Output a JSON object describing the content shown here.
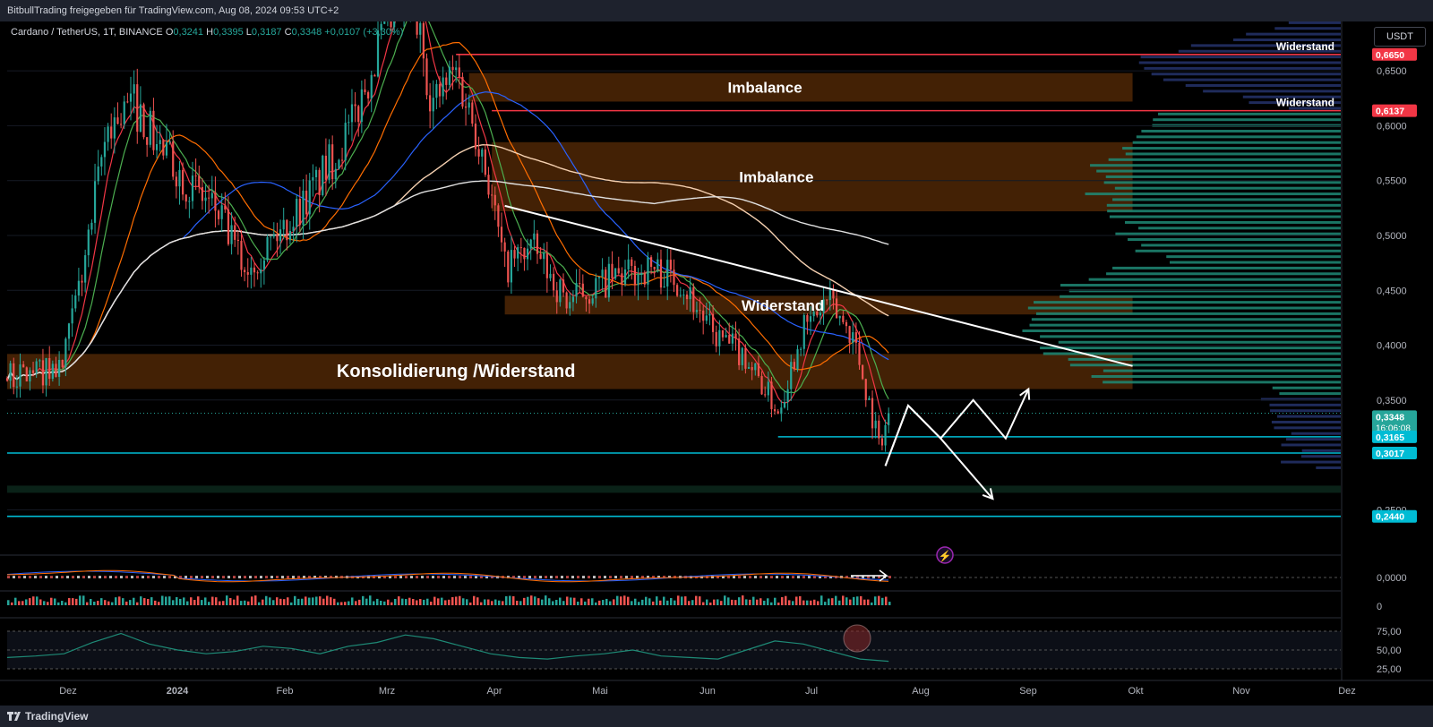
{
  "header": {
    "attribution": "BitbullTrading freigegeben für TradingView.com, Aug 08, 2024 09:53 UTC+2"
  },
  "symbol": {
    "name": "Cardano / TetherUS, 1T, BINANCE",
    "o_label": "O",
    "o_value": "0,3241",
    "h_label": "H",
    "h_value": "0,3395",
    "l_label": "L",
    "l_value": "0,3187",
    "c_label": "C",
    "c_value": "0,3348",
    "change": "+0,0107 (+3,30%)"
  },
  "currency": "USDT",
  "footer": {
    "brand": "TradingView",
    "logo_icon": "tradingview-logo-icon"
  },
  "colors": {
    "background": "#000000",
    "zone_fill": "#7a3d0a",
    "resistance_red": "#f23645",
    "support_cyan": "#00bcd4",
    "volume_profile_green": "#1e8a76",
    "volume_profile_blue": "#24336b",
    "candle_up": "#26a69a",
    "candle_down": "#ef5350",
    "ma_red": "#f23645",
    "ma_green": "#4caf50",
    "ma_orange": "#ff6d00",
    "ma_blue": "#2962ff",
    "ma_beige": "#f5d0b0",
    "ma_white": "#e0e0e0",
    "rsi_line": "#1e8a76"
  },
  "chart_data": {
    "type": "candlestick",
    "timeframe": "1T",
    "price_axis": {
      "ylim": [
        0.225,
        0.695
      ],
      "ticks": [
        "0,6500",
        "0,6000",
        "0,5500",
        "0,5000",
        "0,4500",
        "0,4000",
        "0,3500",
        "0,2500"
      ],
      "tick_values": [
        0.65,
        0.6,
        0.55,
        0.5,
        0.45,
        0.4,
        0.35,
        0.25
      ]
    },
    "price_tags": [
      {
        "label": "0,6650",
        "value": 0.665,
        "color": "#f23645"
      },
      {
        "label": "0,6137",
        "value": 0.6137,
        "color": "#f23645"
      },
      {
        "label": "0,3348",
        "value": 0.3348,
        "color": "#26a69a",
        "countdown": "16:06:08"
      },
      {
        "label": "0,3165",
        "value": 0.3165,
        "color": "#00bcd4"
      },
      {
        "label": "0,3017",
        "value": 0.3017,
        "color": "#00bcd4"
      },
      {
        "label": "0,2440",
        "value": 0.244,
        "color": "#00bcd4"
      }
    ],
    "time_axis": {
      "labels": [
        "Dez",
        "2024",
        "Feb",
        "Mrz",
        "Apr",
        "Mai",
        "Jun",
        "Jul",
        "Aug",
        "Sep",
        "Okt",
        "Nov",
        "Dez"
      ],
      "start": "2023-11-11",
      "end": "2024-12-25"
    },
    "candles_monthly_path": [
      {
        "date": "2023-11-11",
        "price": 0.37
      },
      {
        "date": "2023-11-28",
        "price": 0.38
      },
      {
        "date": "2023-12-05",
        "price": 0.48
      },
      {
        "date": "2023-12-12",
        "price": 0.6
      },
      {
        "date": "2023-12-20",
        "price": 0.62
      },
      {
        "date": "2023-12-28",
        "price": 0.58
      },
      {
        "date": "2024-01-05",
        "price": 0.55
      },
      {
        "date": "2024-01-15",
        "price": 0.52
      },
      {
        "date": "2024-01-23",
        "price": 0.47
      },
      {
        "date": "2024-02-05",
        "price": 0.51
      },
      {
        "date": "2024-02-15",
        "price": 0.55
      },
      {
        "date": "2024-02-25",
        "price": 0.6
      },
      {
        "date": "2024-03-05",
        "price": 0.68
      },
      {
        "date": "2024-03-14",
        "price": 0.72
      },
      {
        "date": "2024-03-21",
        "price": 0.62
      },
      {
        "date": "2024-03-28",
        "price": 0.65
      },
      {
        "date": "2024-04-05",
        "price": 0.58
      },
      {
        "date": "2024-04-12",
        "price": 0.47
      },
      {
        "date": "2024-04-20",
        "price": 0.49
      },
      {
        "date": "2024-05-01",
        "price": 0.44
      },
      {
        "date": "2024-05-15",
        "price": 0.46
      },
      {
        "date": "2024-05-27",
        "price": 0.47
      },
      {
        "date": "2024-06-05",
        "price": 0.46
      },
      {
        "date": "2024-06-15",
        "price": 0.41
      },
      {
        "date": "2024-06-25",
        "price": 0.39
      },
      {
        "date": "2024-07-05",
        "price": 0.34
      },
      {
        "date": "2024-07-12",
        "price": 0.41
      },
      {
        "date": "2024-07-20",
        "price": 0.44
      },
      {
        "date": "2024-07-28",
        "price": 0.41
      },
      {
        "date": "2024-08-05",
        "price": 0.31
      },
      {
        "date": "2024-08-08",
        "price": 0.3348
      }
    ],
    "zones": [
      {
        "label": "Imbalance",
        "from": "2024-04-01",
        "to": "2024-10-22",
        "low": 0.622,
        "high": 0.648
      },
      {
        "label": "Imbalance",
        "from": "2024-04-08",
        "to": "2024-10-22",
        "low": 0.522,
        "high": 0.585
      },
      {
        "label": "Widerstand",
        "from": "2024-04-12",
        "to": "2024-10-22",
        "low": 0.428,
        "high": 0.445
      },
      {
        "label": "Konsolidierung /Widerstand",
        "from": "2023-11-11",
        "to": "2024-10-22",
        "low": 0.36,
        "high": 0.392
      }
    ],
    "horizontal_lines": [
      {
        "label": "Widerstand",
        "value": 0.665,
        "from": "2024-03-28",
        "color": "#f23645"
      },
      {
        "label": "Widerstand",
        "value": 0.6137,
        "from": "2024-04-08",
        "color": "#f23645"
      },
      {
        "value": 0.3165,
        "from": "2024-07-05",
        "color": "#00bcd4"
      },
      {
        "value": 0.3017,
        "from": "2023-11-11",
        "color": "#00bcd4"
      },
      {
        "value": 0.244,
        "from": "2023-11-11",
        "color": "#00bcd4"
      }
    ],
    "trendline": {
      "from": {
        "date": "2024-04-12",
        "price": 0.527
      },
      "to": {
        "date": "2024-10-22",
        "price": 0.381
      }
    },
    "scenarios": [
      {
        "name": "up",
        "points": [
          {
            "date": "2024-08-07",
            "price": 0.29
          },
          {
            "date": "2024-08-14",
            "price": 0.345
          },
          {
            "date": "2024-08-24",
            "price": 0.315
          },
          {
            "date": "2024-09-03",
            "price": 0.35
          },
          {
            "date": "2024-09-13",
            "price": 0.315
          },
          {
            "date": "2024-09-20",
            "price": 0.36
          }
        ]
      },
      {
        "name": "down",
        "points": [
          {
            "date": "2024-08-07",
            "price": 0.29
          },
          {
            "date": "2024-08-14",
            "price": 0.345
          },
          {
            "date": "2024-08-24",
            "price": 0.315
          },
          {
            "date": "2024-09-09",
            "price": 0.26
          }
        ]
      }
    ],
    "indicators": {
      "macd_axis_label": "0,0000",
      "histogram_axis_label": "0",
      "rsi_axis_labels": [
        "75,00",
        "50,00",
        "25,00"
      ],
      "rsi_values": [
        40,
        42,
        45,
        60,
        72,
        58,
        50,
        45,
        48,
        55,
        52,
        45,
        55,
        60,
        70,
        65,
        55,
        45,
        40,
        38,
        42,
        45,
        50,
        42,
        40,
        38,
        50,
        62,
        58,
        48,
        38,
        35
      ]
    }
  }
}
